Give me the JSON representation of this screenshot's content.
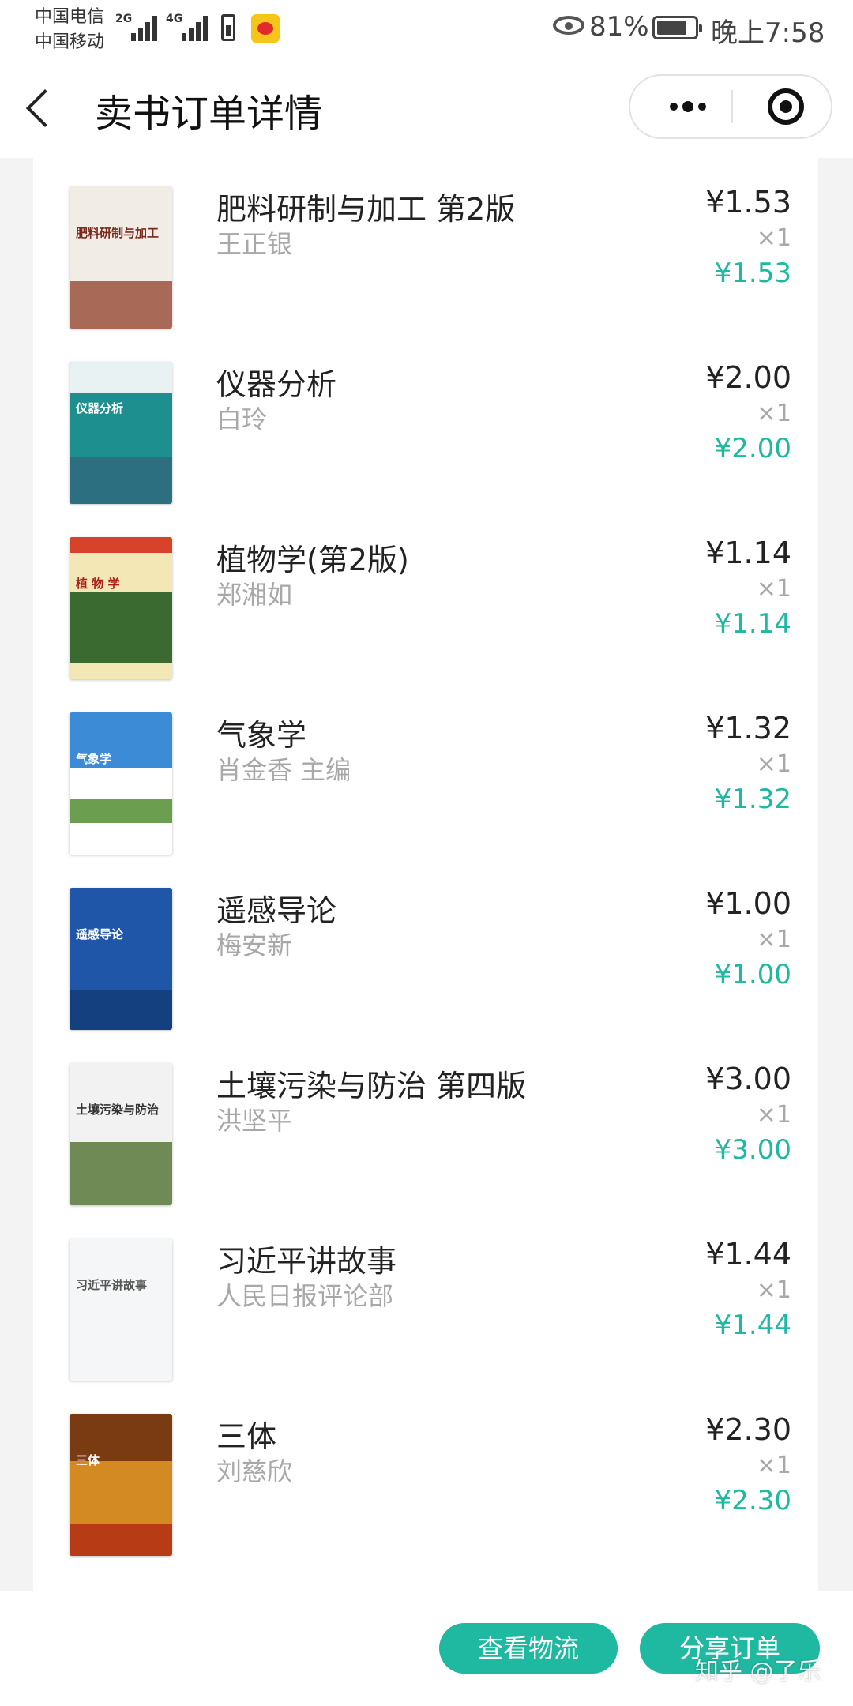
{
  "status_bar": {
    "carrier_1": "中国电信",
    "carrier_2": "中国移动",
    "net_1": "2G",
    "net_2": "4G",
    "battery_percent": "81%",
    "battery_level": 0.81,
    "time": "晚上7:58",
    "icons": [
      "signal-icon",
      "battery-saver-icon",
      "weibo-icon",
      "eye-icon",
      "battery-icon"
    ]
  },
  "nav": {
    "title": "卖书订单详情",
    "back_icon": "chevron-left-icon",
    "more_icon": "more-dots-icon",
    "close_icon": "target-close-icon"
  },
  "items": [
    {
      "title": "肥料研制与加工 第2版",
      "author": "王正银",
      "price": "¥1.53",
      "qty": "×1",
      "subtotal": "¥1.53",
      "cover_text": "肥料研制与加工"
    },
    {
      "title": "仪器分析",
      "author": "白玲",
      "price": "¥2.00",
      "qty": "×1",
      "subtotal": "¥2.00",
      "cover_text": "仪器分析"
    },
    {
      "title": "植物学(第2版)",
      "author": "郑湘如",
      "price": "¥1.14",
      "qty": "×1",
      "subtotal": "¥1.14",
      "cover_text": "植 物 学"
    },
    {
      "title": "气象学",
      "author": "肖金香 主编",
      "price": "¥1.32",
      "qty": "×1",
      "subtotal": "¥1.32",
      "cover_text": "气象学"
    },
    {
      "title": "遥感导论",
      "author": "梅安新",
      "price": "¥1.00",
      "qty": "×1",
      "subtotal": "¥1.00",
      "cover_text": "遥感导论"
    },
    {
      "title": "土壤污染与防治 第四版",
      "author": "洪坚平",
      "price": "¥3.00",
      "qty": "×1",
      "subtotal": "¥3.00",
      "cover_text": "土壤污染与防治"
    },
    {
      "title": "习近平讲故事",
      "author": "人民日报评论部",
      "price": "¥1.44",
      "qty": "×1",
      "subtotal": "¥1.44",
      "cover_text": "习近平讲故事"
    },
    {
      "title": "三体",
      "author": "刘慈欣",
      "price": "¥2.30",
      "qty": "×1",
      "subtotal": "¥2.30",
      "cover_text": "三体"
    }
  ],
  "actions": {
    "logistics": "查看物流",
    "share": "分享订单"
  },
  "watermark": "知乎 @了乐",
  "colors": {
    "accent": "#1fb8a0",
    "page_bg": "#f3f3f3",
    "muted_text": "#a8a8a8"
  }
}
